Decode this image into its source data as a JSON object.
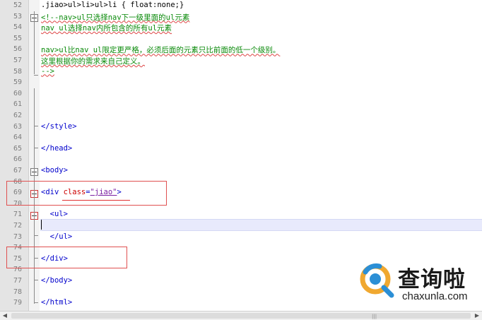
{
  "editor": {
    "lines": [
      {
        "n": "52",
        "kind": "plain",
        "text": ".jiao>ul>li>ul>li { float:none;}"
      },
      {
        "n": "53",
        "kind": "comment",
        "text": "<!--nav>ul只选择nav下一级里面的ul元素"
      },
      {
        "n": "54",
        "kind": "comment",
        "text": "nav ul选择nav内所包含的所有ul元素"
      },
      {
        "n": "55",
        "kind": "blank",
        "text": ""
      },
      {
        "n": "56",
        "kind": "comment",
        "text": "nav>ul比nav ul限定更严格，必须后面的元素只比前面的低一个级别。"
      },
      {
        "n": "57",
        "kind": "comment",
        "text": "这里根据你的需求来自己定义。"
      },
      {
        "n": "58",
        "kind": "comment",
        "text": "-->"
      },
      {
        "n": "59",
        "kind": "blank",
        "text": ""
      },
      {
        "n": "60",
        "kind": "blank",
        "text": ""
      },
      {
        "n": "61",
        "kind": "blank",
        "text": ""
      },
      {
        "n": "62",
        "kind": "blank",
        "text": ""
      },
      {
        "n": "63",
        "kind": "tag",
        "text": "</style>"
      },
      {
        "n": "64",
        "kind": "blank",
        "text": ""
      },
      {
        "n": "65",
        "kind": "tag",
        "text": "</head>"
      },
      {
        "n": "66",
        "kind": "blank",
        "text": ""
      },
      {
        "n": "67",
        "kind": "tag",
        "text": "<body>"
      },
      {
        "n": "68",
        "kind": "blank",
        "text": ""
      },
      {
        "n": "69",
        "kind": "divtag",
        "open": "<div ",
        "attr": "class",
        "eq": "=",
        "val": "\"jiao\"",
        "close": ">"
      },
      {
        "n": "70",
        "kind": "blank",
        "text": ""
      },
      {
        "n": "71",
        "kind": "tag",
        "text": "  <ul>"
      },
      {
        "n": "72",
        "kind": "blank",
        "text": ""
      },
      {
        "n": "73",
        "kind": "tag",
        "text": "  </ul>"
      },
      {
        "n": "74",
        "kind": "blank",
        "text": ""
      },
      {
        "n": "75",
        "kind": "tag",
        "text": "</div>"
      },
      {
        "n": "76",
        "kind": "blank",
        "text": ""
      },
      {
        "n": "77",
        "kind": "tag",
        "text": "</body>"
      },
      {
        "n": "78",
        "kind": "blank",
        "text": ""
      },
      {
        "n": "79",
        "kind": "tag",
        "text": "</html>"
      }
    ]
  },
  "colors": {
    "tag": "#0000cc",
    "attribute": "#cc0000",
    "string": "#7a1fa2",
    "comment": "#0a8a0a",
    "highlight_box": "#e05050",
    "current_line": "#e8eafc"
  },
  "watermark": {
    "icon": "chaxunla-logo-icon",
    "name": "查询啦",
    "domain": "chaxunla.com"
  },
  "scrollbar": {
    "grip": "|||"
  }
}
